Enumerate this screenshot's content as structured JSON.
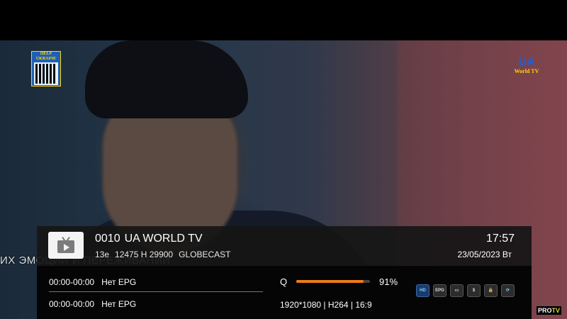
{
  "overlay": {
    "help_logo": {
      "line1": "HELP",
      "line2": "UKRAINE"
    },
    "channel_logo": {
      "line1": "UA",
      "line2": "World TV"
    },
    "subtitle": "ИХ ЭМОЦИЙ И ПЕРЕЖИВАНИЙ"
  },
  "channel": {
    "number": "0010",
    "name": "UA WORLD TV",
    "satellite": "13e",
    "transponder": "12475 H 29900",
    "provider": "GLOBECAST",
    "time": "17:57",
    "date": "23/05/2023 Вт",
    "icon": "tv-play-icon"
  },
  "epg": [
    {
      "time": "00:00-00:00",
      "title": "Нет EPG"
    },
    {
      "time": "00:00-00:00",
      "title": "Нет EPG"
    }
  ],
  "signal": {
    "label": "Q",
    "quality_percent": 91,
    "quality_text": "91%",
    "bar_color": "#f07a1a"
  },
  "video": {
    "info": "1920*1080 | H264 | 16:9"
  },
  "status_icons": [
    {
      "name": "hd-icon",
      "label": "HD"
    },
    {
      "name": "epg-icon",
      "label": "EPG"
    },
    {
      "name": "subtitle-icon",
      "label": "▭"
    },
    {
      "name": "pay-icon",
      "label": "$"
    },
    {
      "name": "lock-icon",
      "label": "🔒"
    },
    {
      "name": "recycle-icon",
      "label": "⟳"
    }
  ],
  "watermark": {
    "text": "PRO",
    "accent": "TV"
  }
}
